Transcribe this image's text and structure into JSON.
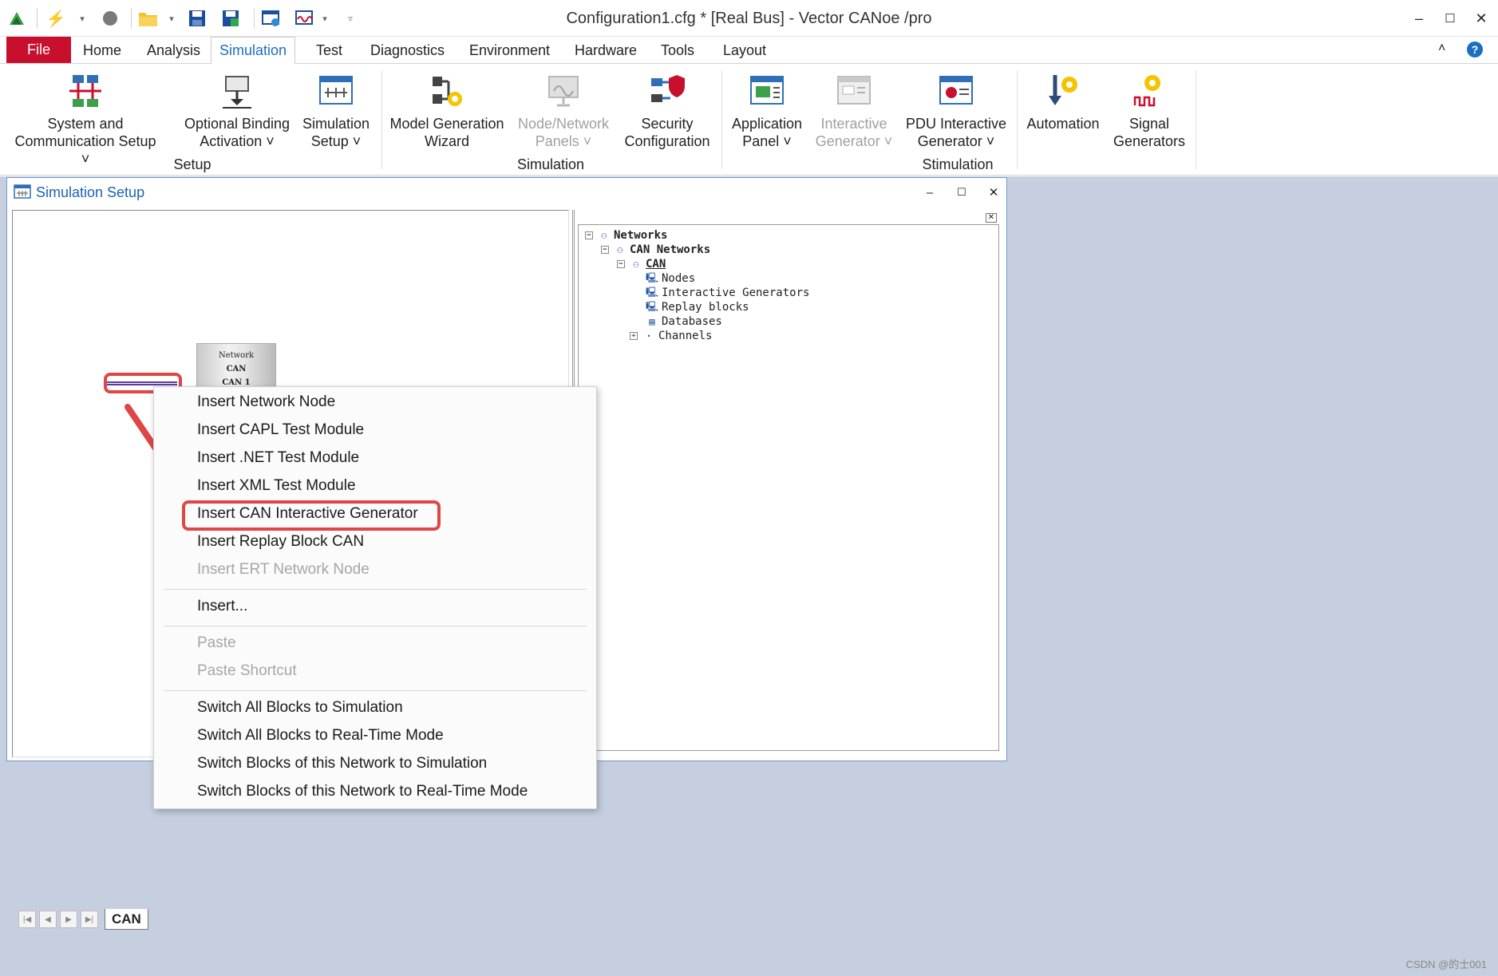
{
  "window": {
    "title": "Configuration1.cfg * [Real Bus] - Vector CANoe /pro",
    "minimize": "–",
    "maximize": "☐",
    "close": "✕"
  },
  "tabs": {
    "file": "File",
    "home": "Home",
    "analysis": "Analysis",
    "simulation": "Simulation",
    "test": "Test",
    "diagnostics": "Diagnostics",
    "environment": "Environment",
    "hardware": "Hardware",
    "tools": "Tools",
    "layout": "Layout",
    "collapse": "˄",
    "help": "?"
  },
  "ribbon": {
    "system_comm_setup": "System and\nCommunication Setup ˅",
    "optional_binding": "Optional Binding\nActivation ˅",
    "simulation_setup": "Simulation\nSetup ˅",
    "model_generation": "Model Generation\nWizard",
    "node_network_panels": "Node/Network\nPanels ˅",
    "security_config": "Security\nConfiguration",
    "application_panel": "Application\nPanel ˅",
    "interactive_generator": "Interactive\nGenerator ˅",
    "pdu_interactive_generator": "PDU Interactive\nGenerator ˅",
    "automation": "Automation",
    "signal_generators": "Signal\nGenerators",
    "group_setup": "Setup",
    "group_simulation": "Simulation",
    "group_stimulation": "Stimulation"
  },
  "sim_window": {
    "title": "Simulation Setup",
    "minimize": "–",
    "maximize": "☐",
    "close": "✕",
    "network_block": {
      "line1": "Network",
      "line2": "CAN",
      "line3": "CAN 1"
    },
    "can_tab": "CAN"
  },
  "tree": {
    "networks": "Networks",
    "can_networks": "CAN Networks",
    "can": "CAN",
    "nodes": "Nodes",
    "interactive_generators": "Interactive Generators",
    "replay_blocks": "Replay blocks",
    "databases": "Databases",
    "channels": "Channels"
  },
  "context_menu": {
    "insert_network_node": "Insert Network Node",
    "insert_capl_test": "Insert CAPL Test Module",
    "insert_net_test": "Insert .NET Test Module",
    "insert_xml_test": "Insert XML Test Module",
    "insert_can_ig": "Insert CAN Interactive Generator",
    "insert_replay_block": "Insert Replay Block CAN",
    "insert_ert_node": "Insert ERT Network Node",
    "insert": "Insert...",
    "paste": "Paste",
    "paste_shortcut": "Paste Shortcut",
    "switch_all_sim": "Switch All Blocks to Simulation",
    "switch_all_rt": "Switch All Blocks to Real-Time Mode",
    "switch_net_sim": "Switch Blocks of this Network to Simulation",
    "switch_net_rt": "Switch Blocks of this Network to Real-Time Mode"
  },
  "watermark": "CSDN @的士001",
  "colors": {
    "file_tab": "#c8102e",
    "active_tab_text": "#1a6fbf",
    "workspace": "#c5cfdf",
    "highlight": "#e04646"
  }
}
